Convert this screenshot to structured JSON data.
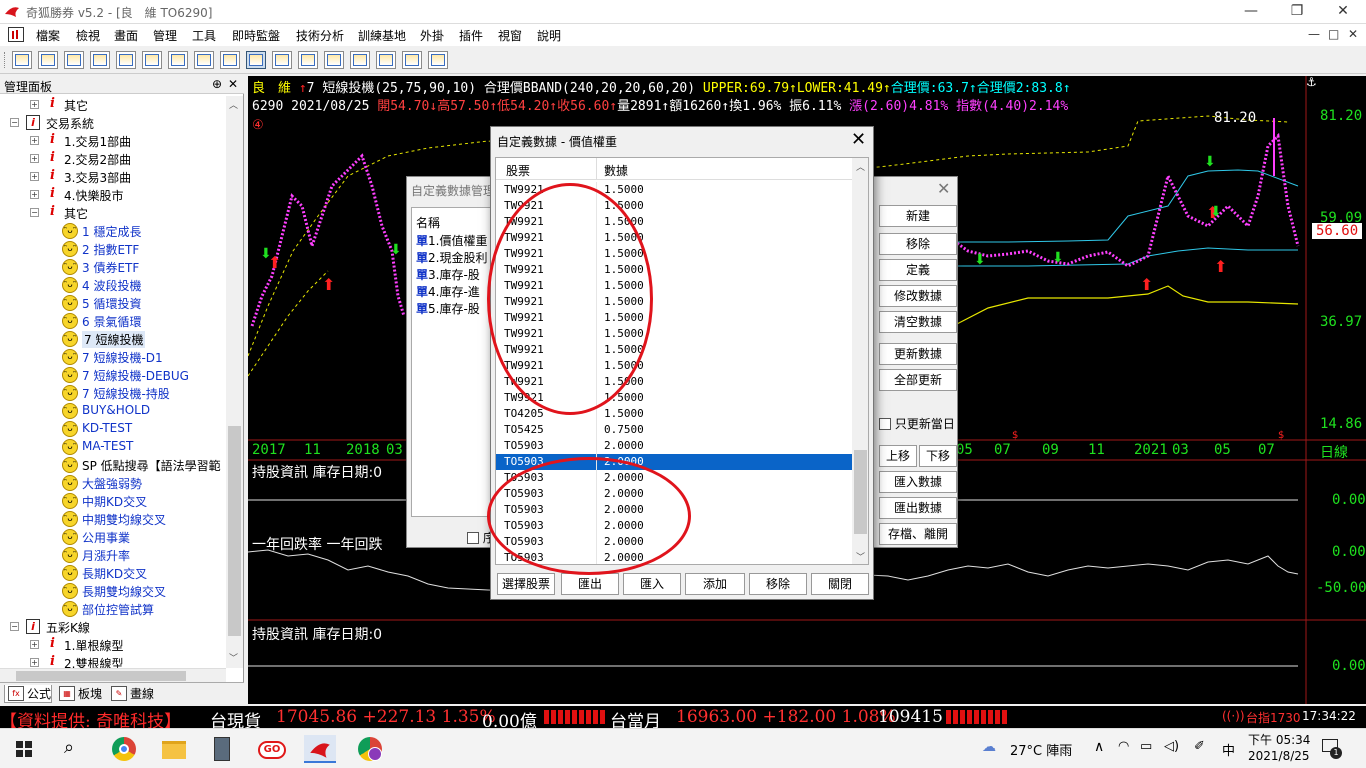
{
  "window": {
    "title": "奇狐勝券 v5.2 - [良　維 TO6290]",
    "controls": [
      "—",
      "❐",
      "✕"
    ]
  },
  "menu": [
    "檔案",
    "檢視",
    "畫面",
    "管理",
    "工具",
    "即時監盤",
    "技術分析",
    "訓練基地",
    "外掛",
    "插件",
    "視窗",
    "說明"
  ],
  "menu_right": [
    "—",
    "□",
    "✕"
  ],
  "left_panel": {
    "title": "管理面板",
    "pin": "ᵖ",
    "close": "✕",
    "tree": [
      {
        "label": "其它",
        "type": "ired",
        "level": 2,
        "exp": "+"
      },
      {
        "label": "交易系統",
        "type": "book",
        "level": 1,
        "exp": "−"
      },
      {
        "label": "1.交易1部曲",
        "type": "ired",
        "level": 2,
        "exp": "+"
      },
      {
        "label": "2.交易2部曲",
        "type": "ired",
        "level": 2,
        "exp": "+"
      },
      {
        "label": "3.交易3部曲",
        "type": "ired",
        "level": 2,
        "exp": "+"
      },
      {
        "label": "4.快樂股市",
        "type": "ired",
        "level": 2,
        "exp": "+"
      },
      {
        "label": "其它",
        "type": "ired",
        "level": 2,
        "exp": "−"
      },
      {
        "label": "1 穩定成長",
        "type": "smile",
        "level": 3
      },
      {
        "label": "2 指數ETF",
        "type": "smile",
        "level": 3
      },
      {
        "label": "3 債券ETF",
        "type": "smile",
        "level": 3
      },
      {
        "label": "4 波段投機",
        "type": "smile",
        "level": 3
      },
      {
        "label": "5 循環投資",
        "type": "smile",
        "level": 3
      },
      {
        "label": "6 景氣循環",
        "type": "smile",
        "level": 3
      },
      {
        "label": "7 短線投機",
        "type": "smile",
        "level": 3,
        "selected": true
      },
      {
        "label": "7 短線投機-D1",
        "type": "smile",
        "level": 3
      },
      {
        "label": "7 短線投機-DEBUG",
        "type": "smile",
        "level": 3
      },
      {
        "label": "7 短線投機-持股",
        "type": "smile",
        "level": 3
      },
      {
        "label": "BUY&HOLD",
        "type": "smile",
        "level": 3
      },
      {
        "label": "KD-TEST",
        "type": "smile",
        "level": 3
      },
      {
        "label": "MA-TEST",
        "type": "smile",
        "level": 3
      },
      {
        "label": "SP 低點搜尋【語法學習範",
        "type": "smile",
        "level": 3,
        "black": true
      },
      {
        "label": "大盤強弱勢",
        "type": "smile",
        "level": 3
      },
      {
        "label": "中期KD交叉",
        "type": "smile",
        "level": 3
      },
      {
        "label": "中期雙均線交叉",
        "type": "smile",
        "level": 3
      },
      {
        "label": "公用事業",
        "type": "smile",
        "level": 3
      },
      {
        "label": "月漲升率",
        "type": "smile",
        "level": 3
      },
      {
        "label": "長期KD交叉",
        "type": "smile",
        "level": 3
      },
      {
        "label": "長期雙均線交叉",
        "type": "smile",
        "level": 3
      },
      {
        "label": "部位控管試算",
        "type": "smile",
        "level": 3
      },
      {
        "label": "五彩K線",
        "type": "book",
        "level": 1,
        "exp": "−"
      },
      {
        "label": "1.單根線型",
        "type": "ired",
        "level": 2,
        "exp": "+"
      },
      {
        "label": "2.雙根線型",
        "type": "ired",
        "level": 2,
        "exp": "+"
      }
    ],
    "tabs": [
      "公式",
      "板塊",
      "畫線"
    ]
  },
  "chart": {
    "line1": [
      {
        "t": "良　維",
        "c": "#ffff00"
      },
      {
        "t": " ↑",
        "c": "#ff2020"
      },
      {
        "t": "7 短線投機(25,75,90,10) 合理價BBAND(240,20,20,60,20) ",
        "c": "#ffffff"
      },
      {
        "t": "UPPER:69.79↑",
        "c": "#ffff00"
      },
      {
        "t": "LOWER:41.49↑",
        "c": "#ffff00"
      },
      {
        "t": "合理價:63.7↑",
        "c": "#00ffff"
      },
      {
        "t": "合理價2:83.8↑",
        "c": "#00ffff"
      }
    ],
    "line2": [
      {
        "t": "6290 2021/08/25 ",
        "c": "#ffffff"
      },
      {
        "t": "開54.70↓",
        "c": "#ff4040"
      },
      {
        "t": "高57.50↑",
        "c": "#ff4040"
      },
      {
        "t": "低54.20↑",
        "c": "#ff4040"
      },
      {
        "t": "收56.60↑",
        "c": "#ff4040"
      },
      {
        "t": "量2891↑",
        "c": "#ffffff"
      },
      {
        "t": "額16260↑",
        "c": "#ffffff"
      },
      {
        "t": "換1.96%",
        "c": "#ffffff"
      },
      {
        "t": " 振6.11%",
        "c": "#ffffff"
      },
      {
        "t": " 漲(2.60)4.81%",
        "c": "#ff40ff"
      },
      {
        "t": " 指數(4.40)2.14%",
        "c": "#ff40ff"
      }
    ],
    "circle_num": "④",
    "hi_label": "81.20",
    "y_axis": [
      "81.20",
      "59.09",
      "36.97",
      "14.86"
    ],
    "price_tag": "56.60",
    "x_axis": [
      "2017",
      "11",
      "2018",
      "03",
      "05",
      "07",
      "09",
      "11",
      "2021",
      "03",
      "05",
      "07"
    ],
    "x_right": "日線",
    "panel2": {
      "label": "持股資訊 庫存日期:0",
      "axis": "0.00"
    },
    "panel3": {
      "label": "一年回跌率 一年回跌",
      "axis": [
        "0.00",
        "-50.00"
      ]
    },
    "panel4": {
      "label": "持股資訊 庫存日期:0",
      "axis": "0.00"
    }
  },
  "back_dialog": {
    "title": "自定義數據管理",
    "list_header": "名稱",
    "items": [
      {
        "u": "單",
        "t": "1.價值權重"
      },
      {
        "u": "單",
        "t": "2.現金股利"
      },
      {
        "u": "單",
        "t": "3.庫存-股"
      },
      {
        "u": "單",
        "t": "4.庫存-進"
      },
      {
        "u": "單",
        "t": "5.庫存-股"
      }
    ],
    "buttons": [
      "新建",
      "移除",
      "定義",
      "修改數據",
      "清空數據",
      "更新數據",
      "全部更新"
    ],
    "checkbox": "只更新當日",
    "move_buttons": [
      "上移",
      "下移"
    ],
    "io_buttons": [
      "匯入數據",
      "匯出數據",
      "存檔、離開"
    ],
    "bottom_check": "序"
  },
  "dialog": {
    "title": "自定義數據 - 價值權重",
    "close": "✕",
    "col1": "股票",
    "col2": "數據",
    "rows": [
      [
        "TW9921",
        "1.5000"
      ],
      [
        "TW9921",
        "1.5000"
      ],
      [
        "TW9921",
        "1.5000"
      ],
      [
        "TW9921",
        "1.5000"
      ],
      [
        "TW9921",
        "1.5000"
      ],
      [
        "TW9921",
        "1.5000"
      ],
      [
        "TW9921",
        "1.5000"
      ],
      [
        "TW9921",
        "1.5000"
      ],
      [
        "TW9921",
        "1.5000"
      ],
      [
        "TW9921",
        "1.5000"
      ],
      [
        "TW9921",
        "1.5000"
      ],
      [
        "TW9921",
        "1.5000"
      ],
      [
        "TW9921",
        "1.5000"
      ],
      [
        "TW9921",
        "1.5000"
      ],
      [
        "TO4205",
        "1.5000"
      ],
      [
        "TO5425",
        "0.7500"
      ],
      [
        "TO5903",
        "2.0000"
      ],
      [
        "TO5903",
        "2.0000"
      ],
      [
        "TO5903",
        "2.0000"
      ],
      [
        "TO5903",
        "2.0000"
      ],
      [
        "TO5903",
        "2.0000"
      ],
      [
        "TO5903",
        "2.0000"
      ],
      [
        "TO5903",
        "2.0000"
      ],
      [
        "TO5903",
        "2.0000"
      ]
    ],
    "selected_row": 17,
    "buttons": [
      "選擇股票",
      "匯出",
      "匯入",
      "添加",
      "移除",
      "關閉"
    ]
  },
  "status_bar": {
    "items": [
      {
        "t": "【資料提供: 奇唯科技】",
        "c": "#ff2a2a"
      },
      {
        "t": "台現貨",
        "c": "#ffffff"
      },
      {
        "t": "17045.86 +227.13 1.35%",
        "c": "#ff3030"
      },
      {
        "t": "0.00億",
        "c": "#ffffff"
      },
      {
        "t": "台當月",
        "c": "#ffffff"
      },
      {
        "t": "16963.00 +182.00 1.08%",
        "c": "#ff3030"
      },
      {
        "t": "109415",
        "c": "#ffffff"
      }
    ],
    "right_label": "台指1730",
    "time": "17:34:22"
  },
  "taskbar": {
    "weather": "27°C 陣雨",
    "ime": "中",
    "time": "下午 05:34",
    "date": "2021/8/25",
    "notif": "1"
  }
}
